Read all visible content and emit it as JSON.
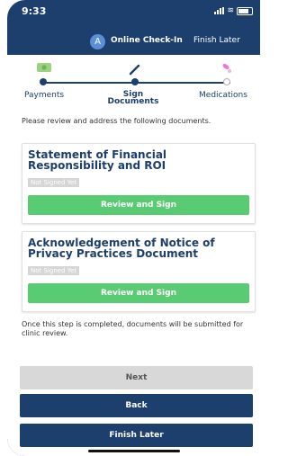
{
  "status_bar": {
    "time": "9:33"
  },
  "app_bar": {
    "avatar_initial": "A",
    "title": "Online Check-In",
    "finish_later": "Finish Later"
  },
  "steps": [
    {
      "label": "Payments",
      "state": "completed"
    },
    {
      "label": "Sign Documents",
      "state": "active"
    },
    {
      "label": "Medications",
      "state": "upcoming"
    }
  ],
  "instructions": "Please review and address the following documents.",
  "documents": [
    {
      "title": "Statement of Financial Responsibility and ROI",
      "status": "Not Signed Yet",
      "action": "Review and Sign"
    },
    {
      "title": "Acknowledgement of Notice of Privacy Practices Document",
      "status": "Not Signed Yet",
      "action": "Review and Sign"
    }
  ],
  "footer_note": "Once this step is completed, documents will be submitted for clinic review.",
  "buttons": {
    "next": "Next",
    "back": "Back",
    "finish_later": "Finish Later"
  },
  "colors": {
    "primary": "#1c3f6e",
    "success": "#59cc73",
    "disabled": "#d8d8d8",
    "badge": "#d6d6d6"
  }
}
